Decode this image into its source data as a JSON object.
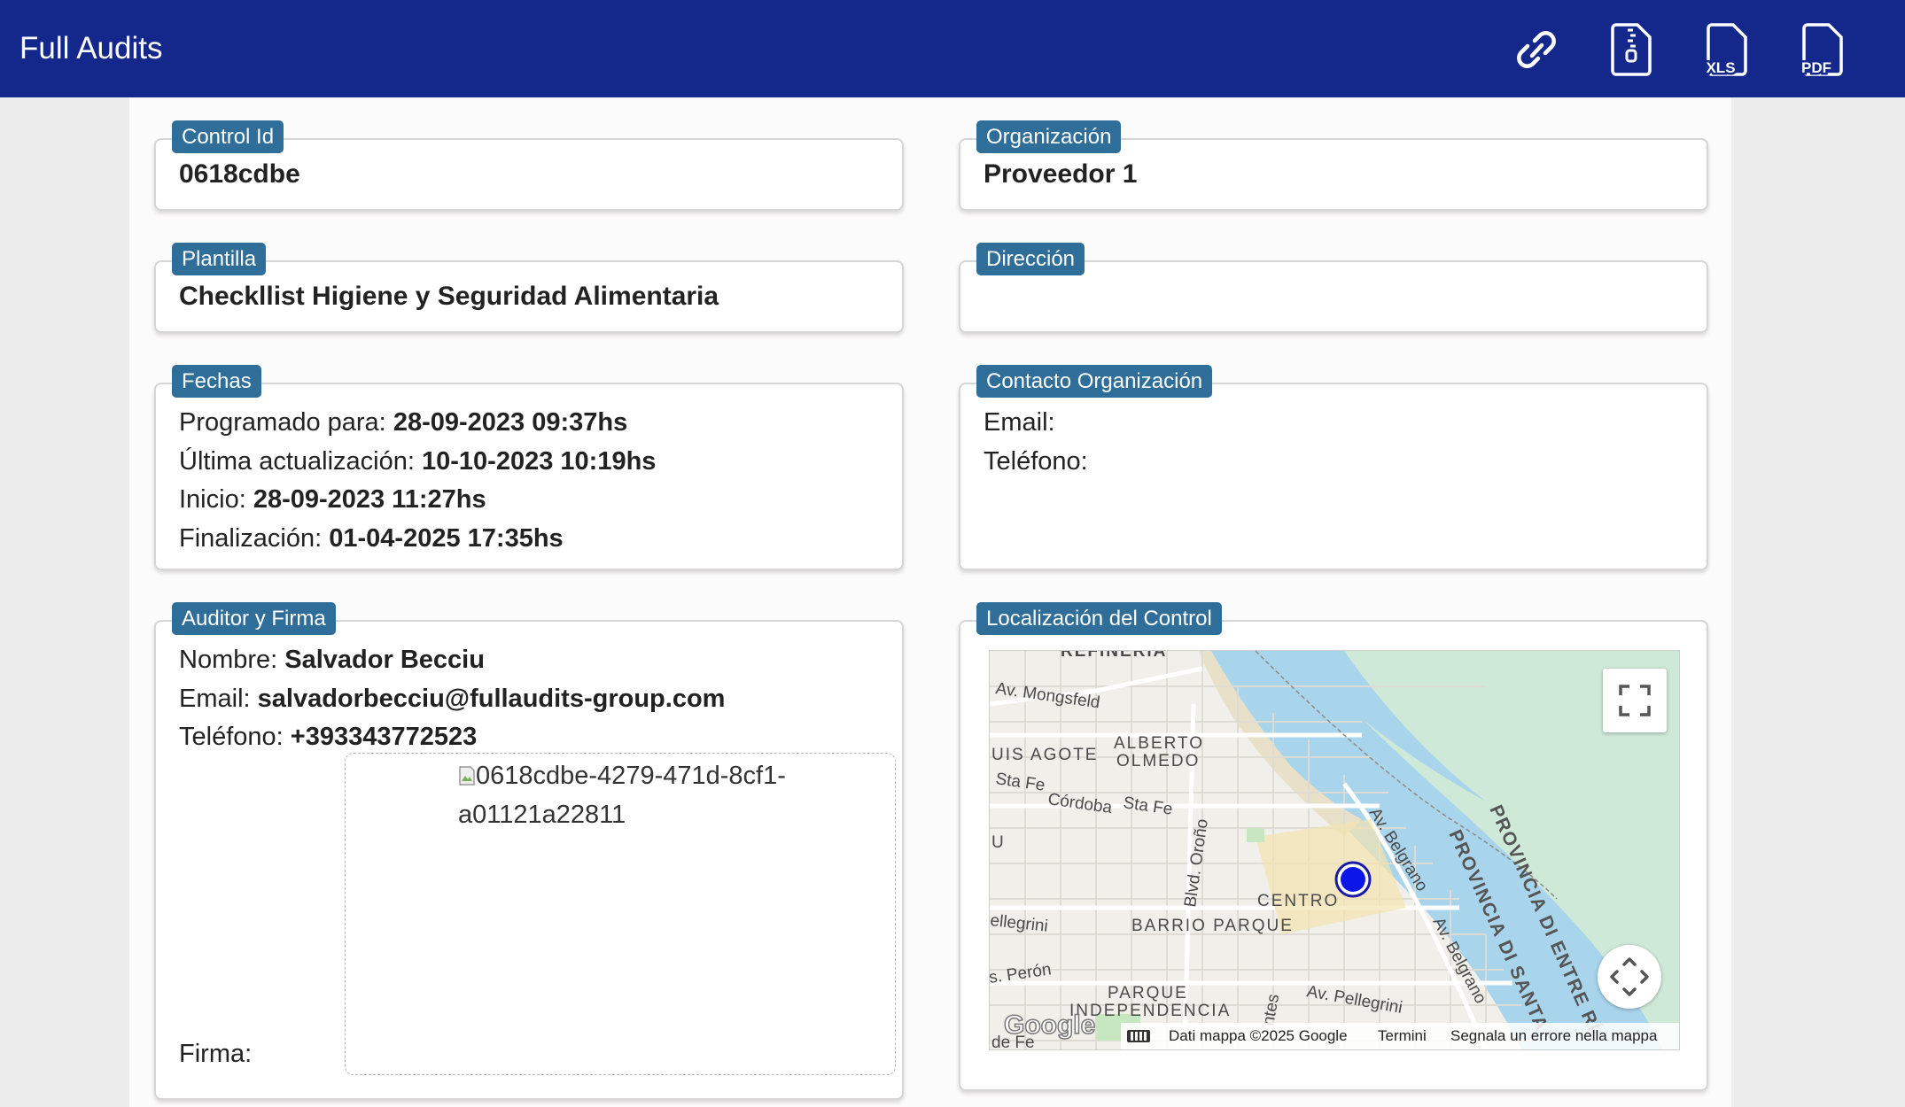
{
  "app": {
    "title": "Full Audits"
  },
  "toolbar": {
    "xls_label": "XLS",
    "pdf_label": "PDF"
  },
  "control": {
    "label": "Control Id",
    "value": "0618cdbe"
  },
  "organization": {
    "label": "Organización",
    "value": "Proveedor 1"
  },
  "template": {
    "label": "Plantilla",
    "value": "Checkllist Higiene y Seguridad Alimentaria"
  },
  "address": {
    "label": "Dirección",
    "value": ""
  },
  "dates": {
    "label": "Fechas",
    "scheduled_label": "Programado para:",
    "scheduled": "28-09-2023 09:37hs",
    "updated_label": "Última actualización:",
    "updated": "10-10-2023 10:19hs",
    "start_label": "Inicio:",
    "start": "28-09-2023 11:27hs",
    "end_label": "Finalización:",
    "end": "01-04-2025 17:35hs"
  },
  "contact": {
    "label": "Contacto Organización",
    "email_label": "Email:",
    "email": "",
    "phone_label": "Teléfono:",
    "phone": ""
  },
  "auditor": {
    "label": "Auditor y Firma",
    "name_label": "Nombre:",
    "name": "Salvador Becciu",
    "email_label": "Email:",
    "email": "salvadorbecciu@fullaudits-group.com",
    "phone_label": "Teléfono:",
    "phone": "+393343772523",
    "signature_alt": "0618cdbe-4279-471d-8cf1-a01121a22811",
    "signature_label": "Firma:"
  },
  "location": {
    "label": "Localización del Control",
    "map_labels": {
      "refineria": "REFINERIA",
      "mongsfeld": "Av. Mongsfeld",
      "agote": "UIS AGOTE",
      "alberto": "ALBERTO",
      "olmedo": "OLMEDO",
      "stafe1": "Sta Fe",
      "stafe2": "Sta Fe",
      "cordoba": "Córdoba",
      "u": "U",
      "orono": "Blvd. Oroño",
      "belgrano1": "Av. Belgrano",
      "belgrano2": "Av. Belgrano",
      "centro": "CENTRO",
      "barrio": "BARRIO PARQUE",
      "pellegrini_w": "ellegrini",
      "peron": "s. Perón",
      "parque": "PARQUE",
      "independencia": "INDEPENDENCIA",
      "pellegrini": "Av. Pellegrini",
      "ntes": "ntes",
      "santa": "PROVINCIA DI SANTA",
      "entre": "PROVINCIA DI ENTRE RÍ",
      "defe": "de Fe"
    },
    "google_logo": "Google",
    "attribution": "Dati mappa ©2025 Google",
    "terms": "Termini",
    "report": "Segnala un errore nella mappa"
  }
}
